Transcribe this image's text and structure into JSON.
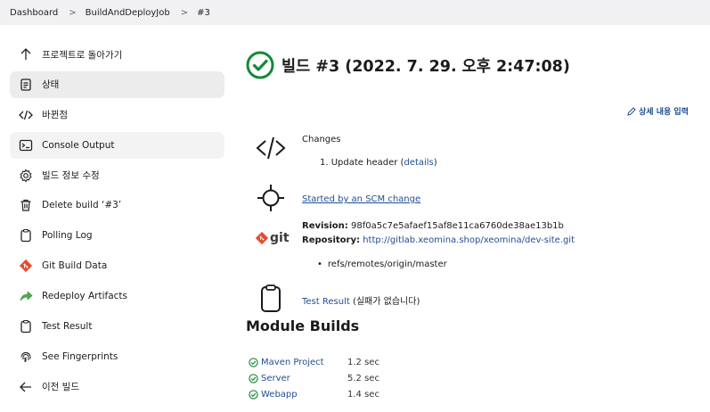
{
  "breadcrumb": [
    "Dashboard",
    "BuildAndDeployJob",
    "#3"
  ],
  "sidebar": {
    "items": [
      {
        "label": "프로젝트로 돌아가기",
        "icon": "arrow-up-icon",
        "state": "normal"
      },
      {
        "label": "상태",
        "icon": "document-icon",
        "state": "active"
      },
      {
        "label": "바뀐점",
        "icon": "code-icon",
        "state": "normal"
      },
      {
        "label": "Console Output",
        "icon": "terminal-icon",
        "state": "hover"
      },
      {
        "label": "빌드 정보 수정",
        "icon": "gear-icon",
        "state": "normal"
      },
      {
        "label": "Delete build ‘#3’",
        "icon": "trash-icon",
        "state": "normal"
      },
      {
        "label": "Polling Log",
        "icon": "clipboard-icon",
        "state": "normal"
      },
      {
        "label": "Git Build Data",
        "icon": "git-icon",
        "state": "normal"
      },
      {
        "label": "Redeploy Artifacts",
        "icon": "redeploy-icon",
        "state": "normal"
      },
      {
        "label": "Test Result",
        "icon": "clipboard-icon",
        "state": "normal"
      },
      {
        "label": "See Fingerprints",
        "icon": "fingerprint-icon",
        "state": "normal"
      },
      {
        "label": "이전 빌드",
        "icon": "arrow-left-icon",
        "state": "normal"
      }
    ]
  },
  "main": {
    "title": "빌드 #3 (2022. 7. 29. 오후 2:47:08)",
    "edit_label": "상세 내용 입력",
    "changes": {
      "heading": "Changes",
      "item_prefix": "1. Update header (",
      "item_link": "details",
      "item_suffix": ")"
    },
    "started_by": "Started by an SCM change",
    "git": {
      "logo_text": "git",
      "revision_label": "Revision:",
      "revision": "98f0a5c7e5afaef15af8e11ca6760de38ae13b1b",
      "repository_label": "Repository:",
      "repository": "http://gitlab.xeomina.shop/xeomina/dev-site.git",
      "branch": "refs/remotes/origin/master"
    },
    "test_result": {
      "link": "Test Result",
      "note": " (실패가 없습니다)"
    },
    "module_builds": {
      "title": "Module Builds",
      "rows": [
        {
          "name": "Maven Project",
          "duration": "1.2 sec"
        },
        {
          "name": "Server",
          "duration": "5.2 sec"
        },
        {
          "name": "Webapp",
          "duration": "1.4 sec"
        }
      ]
    }
  },
  "colors": {
    "link": "#1f4e93",
    "success": "#138a36",
    "active_bg": "#ececec"
  }
}
